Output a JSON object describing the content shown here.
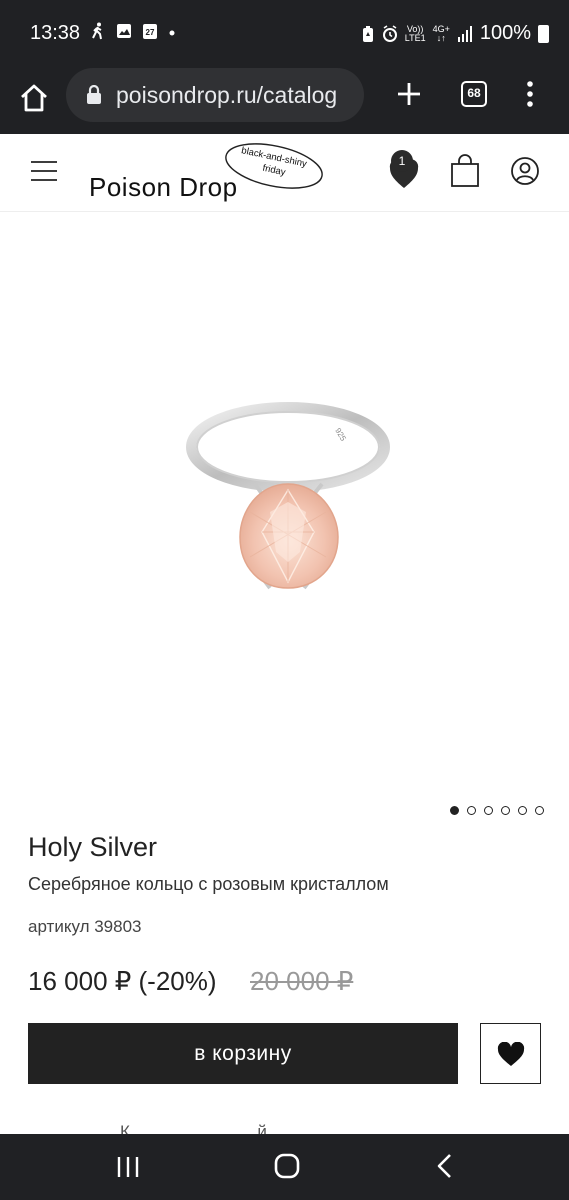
{
  "status_bar": {
    "time": "13:38",
    "calendar_day": "27",
    "volte": "Vo))",
    "lte": "LTE1",
    "network": "4G+",
    "battery": "100%"
  },
  "browser": {
    "url": "poisondrop.ru/catalog",
    "tab_count": "68"
  },
  "header": {
    "logo": "Poison Drop",
    "promo_line1": "black-and-shiny",
    "promo_line2": "friday",
    "favorites_count": "1"
  },
  "gallery": {
    "slide_count": 6,
    "active_slide": 1,
    "ring_engraving": "925"
  },
  "product": {
    "title": "Holy Silver",
    "description": "Серебряное кольцо с розовым кристаллом",
    "sku": "артикул 39803",
    "price": "16 000 ₽  (-20%)",
    "old_price": "20 000 ₽",
    "add_to_cart": "в корзину"
  },
  "partial_text": "К...........................й",
  "colors": {
    "system_bar": "#202124",
    "button_dark": "#222222",
    "gem": "#f2c3b0"
  }
}
